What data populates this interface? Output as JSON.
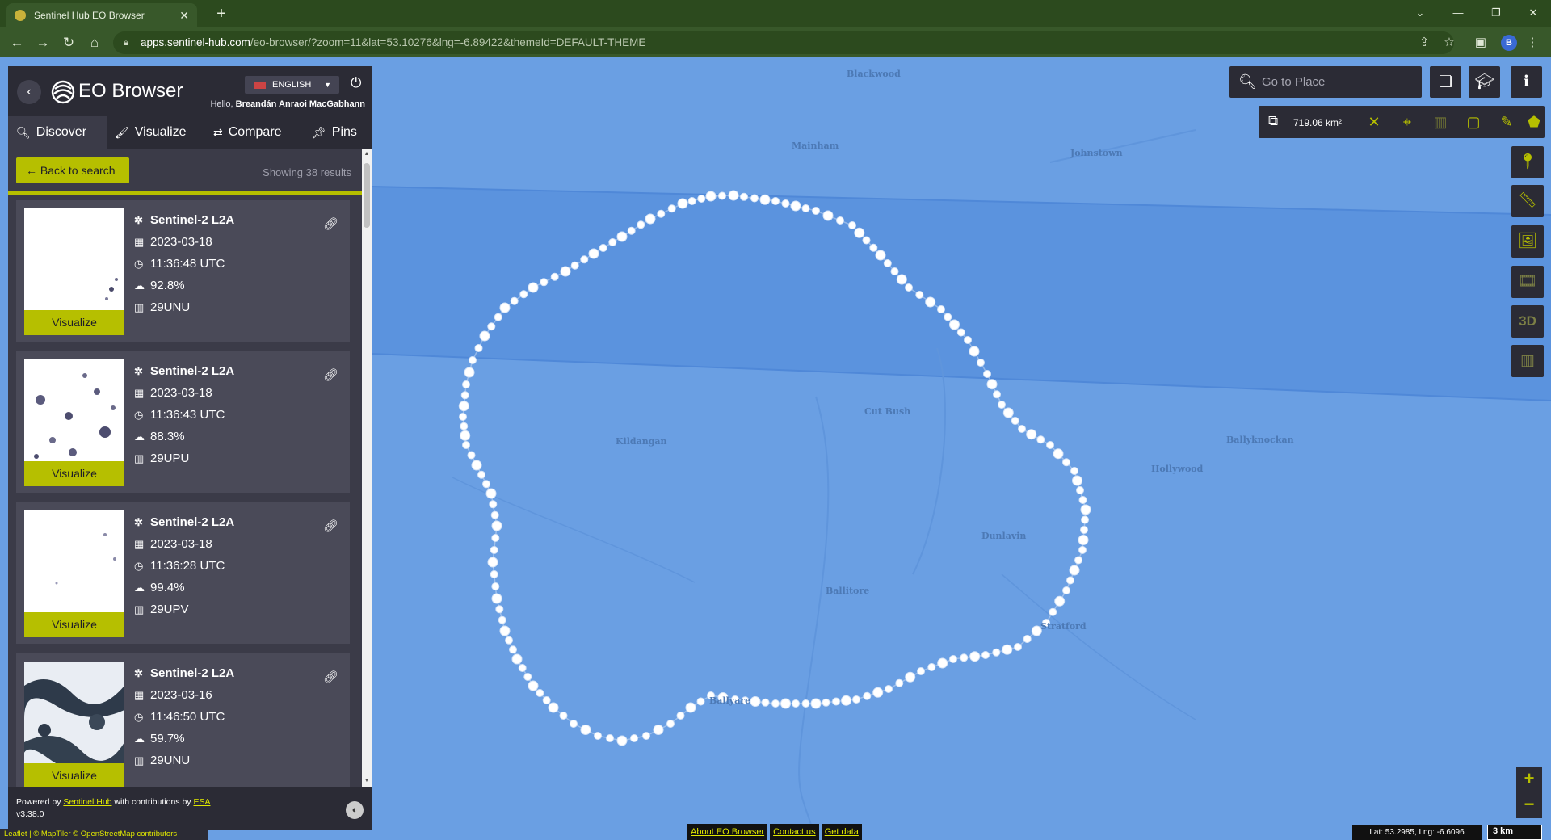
{
  "browser": {
    "tab_title": "Sentinel Hub EO Browser",
    "tab_close": "✕",
    "new_tab": "+",
    "url_host": "apps.sentinel-hub.com",
    "url_path": "/eo-browser/?zoom=11&lat=53.10276&lng=-6.89422&themeId=DEFAULT-THEME",
    "profile_initial": "B"
  },
  "sidebar": {
    "brand": "EO Browser",
    "language": "ENGLISH",
    "greeting_prefix": "Hello, ",
    "user_name": "Breandán Anraoi MacGabhann",
    "tabs": [
      {
        "label": "Discover",
        "icon": "search-icon"
      },
      {
        "label": "Visualize",
        "icon": "paintbrush-icon"
      },
      {
        "label": "Compare",
        "icon": "compare-arrows-icon"
      },
      {
        "label": "Pins",
        "icon": "pin-icon"
      }
    ],
    "back_to_search": "Back to search",
    "showing": "Showing 38 results",
    "results": [
      {
        "title": "Sentinel-2 L2A",
        "date": "2023-03-18",
        "time": "11:36:48 UTC",
        "cloud": "92.8%",
        "tile": "29UNU",
        "visualize": "Visualize"
      },
      {
        "title": "Sentinel-2 L2A",
        "date": "2023-03-18",
        "time": "11:36:43 UTC",
        "cloud": "88.3%",
        "tile": "29UPU",
        "visualize": "Visualize"
      },
      {
        "title": "Sentinel-2 L2A",
        "date": "2023-03-18",
        "time": "11:36:28 UTC",
        "cloud": "99.4%",
        "tile": "29UPV",
        "visualize": "Visualize"
      },
      {
        "title": "Sentinel-2 L2A",
        "date": "2023-03-16",
        "time": "11:46:50 UTC",
        "cloud": "59.7%",
        "tile": "29UNU",
        "visualize": "Visualize"
      }
    ],
    "footer": {
      "powered_by": "Powered by ",
      "sentinel_hub": "Sentinel Hub",
      "contributions": " with contributions by ",
      "esa": "ESA",
      "version": "v3.38.0"
    }
  },
  "map": {
    "search_placeholder": "Go to Place",
    "aoi_area": "719.06 km²",
    "three_d": "3D",
    "zoom_in": "+",
    "zoom_out": "−",
    "links": [
      "About EO Browser",
      "Contact us",
      "Get data"
    ],
    "coords": "Lat: 53.2985, Lng: -6.6096",
    "scale": "3 km",
    "attribution": "Leaflet | © MapTiler © OpenStreetMap contributors",
    "colors": {
      "accent": "#b6bf00",
      "panel": "#2b2b35",
      "map": "#6a9fe3"
    }
  }
}
